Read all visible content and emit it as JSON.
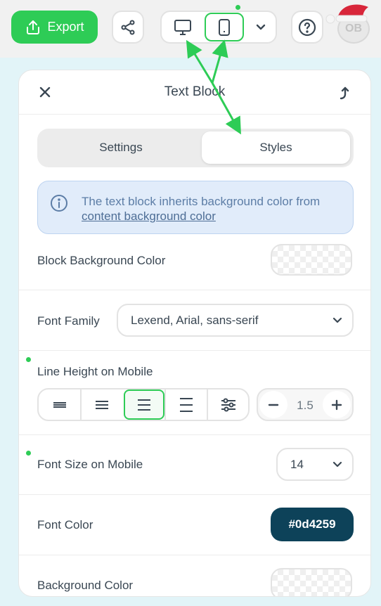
{
  "toolbar": {
    "export_label": "Export",
    "avatar_initials": "OB",
    "accent_color": "#2ecc56"
  },
  "panel": {
    "title": "Text Block",
    "tabs": [
      {
        "label": "Settings",
        "active": false
      },
      {
        "label": "Styles",
        "active": true
      }
    ],
    "info": {
      "text": "The text block inherits background color from",
      "link": "content background color"
    },
    "rows": {
      "block_bg_label": "Block Background Color",
      "font_family_label": "Font Family",
      "font_family_value": "Lexend, Arial, sans-serif",
      "line_height_label": "Line Height on Mobile",
      "line_height_value": "1.5",
      "font_size_label": "Font Size on Mobile",
      "font_size_value": "14",
      "font_color_label": "Font Color",
      "font_color_value": "#0d4259",
      "background_color_label": "Background Color"
    },
    "line_height_options": [
      "tight-icon",
      "compact-icon",
      "normal-icon",
      "loose-icon",
      "custom-sliders-icon"
    ],
    "line_height_selected_index": 2
  }
}
